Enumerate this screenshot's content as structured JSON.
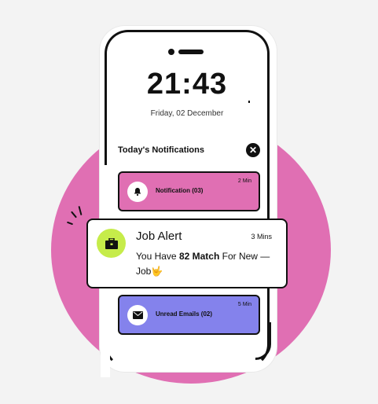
{
  "lockscreen": {
    "time": "21:43",
    "date": "Friday, 02 December"
  },
  "notifications": {
    "section_title": "Today's Notifications",
    "close_glyph": "✕",
    "items": [
      {
        "label": "Notification (03)",
        "time": "2 Min",
        "color": "#e06fb3",
        "icon": "bell-icon"
      },
      {
        "label": "Unread Emails (02)",
        "time": "5 Min",
        "color": "#8482ec",
        "icon": "mail-icon"
      }
    ]
  },
  "job_alert": {
    "title": "Job Alert",
    "time": "3 Mins",
    "body_prefix": "You Have ",
    "body_highlight": "82 Match",
    "body_suffix": " For New — Job",
    "emoji": "🤟",
    "icon": "briefcase-icon",
    "icon_color": "#c6ec4a"
  },
  "colors": {
    "accent_pink": "#e06fb3",
    "accent_purple": "#8482ec",
    "accent_lime": "#c6ec4a"
  }
}
